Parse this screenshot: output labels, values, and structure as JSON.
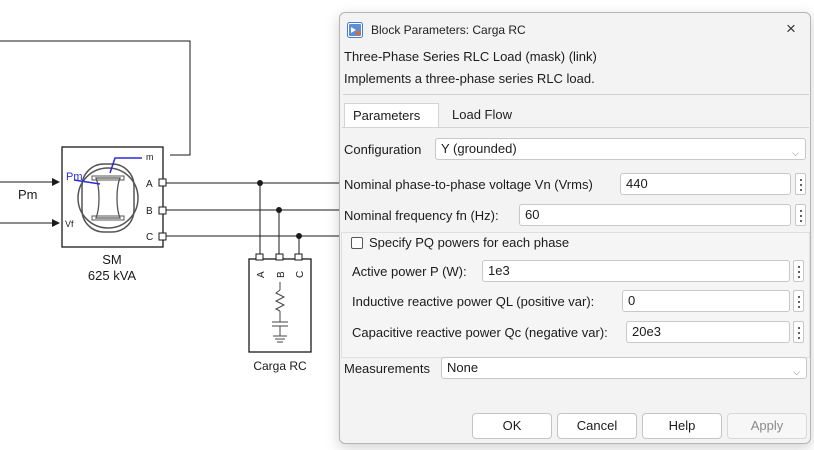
{
  "diagram": {
    "machine_port_m": "m",
    "machine_port_a": "A",
    "machine_port_b": "B",
    "machine_port_c": "C",
    "machine_port_pm": "Pm",
    "machine_port_vf": "Vf",
    "input_pm_label": "Pm",
    "machine_name": "SM",
    "machine_rating": "625 kVA",
    "load_port_a": "A",
    "load_port_b": "B",
    "load_port_c": "C",
    "load_name": "Carga RC"
  },
  "dialog": {
    "title": "Block Parameters: Carga RC",
    "header_line1": "Three-Phase Series RLC Load (mask) (link)",
    "header_line2": "Implements a three-phase series RLC load.",
    "tabs": [
      {
        "label": "Parameters",
        "active": true
      },
      {
        "label": "Load Flow",
        "active": false
      }
    ],
    "configuration": {
      "label": "Configuration",
      "value": "Y (grounded)"
    },
    "nominal_voltage": {
      "label": "Nominal phase-to-phase voltage Vn (Vrms)",
      "value": "440"
    },
    "nominal_frequency": {
      "label": "Nominal frequency fn (Hz):",
      "value": "60"
    },
    "specify_pq": {
      "label": "Specify PQ powers for each phase",
      "checked": false
    },
    "active_power": {
      "label": "Active power P (W):",
      "value": "1e3"
    },
    "inductive_power": {
      "label": "Inductive reactive power QL (positive var):",
      "value": "0"
    },
    "capacitive_power": {
      "label": "Capacitive reactive power Qc (negative var):",
      "value": "20e3"
    },
    "measurements": {
      "label": "Measurements",
      "value": "None"
    },
    "buttons": {
      "ok": "OK",
      "cancel": "Cancel",
      "help": "Help",
      "apply": "Apply"
    }
  },
  "colors": {
    "accent_blue": "#2f63b8",
    "machine_blue": "#2b2bd9",
    "diagram_line": "#1a1a1a"
  },
  "icons": {
    "app": "simulink-block-icon",
    "close": "close-icon",
    "dropdown": "chevron-down-icon",
    "more": "vertical-ellipsis-icon"
  }
}
